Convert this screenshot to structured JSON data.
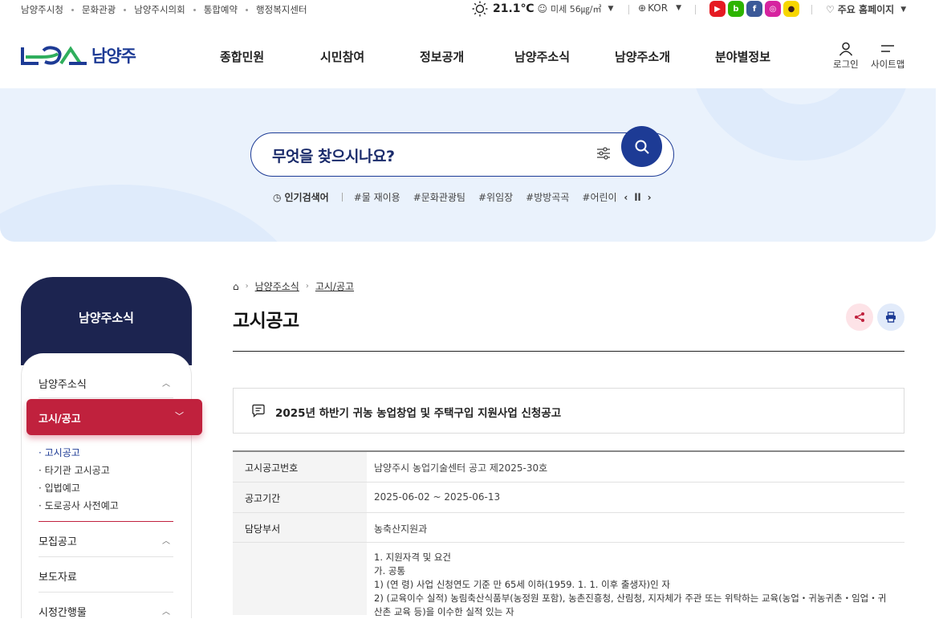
{
  "topbar": {
    "links": [
      "남양주시청",
      "문화관광",
      "남양주시의회",
      "통합예약",
      "행정복지센터"
    ],
    "temperature": "21.1℃",
    "fine_dust": "미세 56㎍/㎥",
    "language": "KOR",
    "sns": [
      {
        "name": "youtube-icon",
        "color": "#e51b23",
        "glyph": "▶"
      },
      {
        "name": "blog-icon",
        "color": "#2db400",
        "glyph": "b"
      },
      {
        "name": "facebook-icon",
        "color": "#3b5998",
        "glyph": "f"
      },
      {
        "name": "instagram-icon",
        "color": "#d6249f",
        "glyph": "◎"
      },
      {
        "name": "kakao-icon",
        "color": "#f7d600",
        "glyph": "●"
      }
    ],
    "main_home": "주요 홈페이지"
  },
  "header": {
    "logo_text": "남양주",
    "nav": [
      "종합민원",
      "시민참여",
      "정보공개",
      "남양주소식",
      "남양주소개",
      "분야별정보"
    ],
    "login": "로그인",
    "sitemap": "사이트맵"
  },
  "search": {
    "placeholder": "무엇을 찾으시나요?",
    "popular_title": "인기검색어",
    "tags": [
      "#물 재이용",
      "#문화관광팀",
      "#위임장",
      "#방방곡곡",
      "#어린이"
    ]
  },
  "sidebar": {
    "title": "남양주소식",
    "items": [
      {
        "label": "남양주소식"
      },
      {
        "label": "고시/공고"
      },
      {
        "label": "모집공고"
      },
      {
        "label": "보도자료"
      },
      {
        "label": "시정간행물"
      }
    ],
    "sub_items": [
      "고시공고",
      "타기관 고시공고",
      "입법예고",
      "도로공사 사전예고"
    ]
  },
  "breadcrumb": [
    "남양주소식",
    "고시/공고"
  ],
  "page_title": "고시공고",
  "notice": {
    "title": "2025년 하반기 귀농 농업창업 및 주택구입 지원사업 신청공고",
    "rows": [
      {
        "label": "고시공고번호",
        "value": "남양주시 농업기술센터 공고 제2025-30호"
      },
      {
        "label": "공고기간",
        "value": "2025-06-02 ~ 2025-06-13"
      },
      {
        "label": "담당부서",
        "value": "농축산지원과"
      }
    ],
    "detail_lines": [
      "1. 지원자격 및 요건",
      "가. 공통",
      "1) (연 령) 사업 신청연도 기준 만 65세 이하(1959. 1. 1. 이후 출생자)인 자",
      "2) (교육이수 실적) 농림축산식품부(농정원 포함), 농촌진흥청, 산림청, 지자체가 주관 또는 위탁하는 교육(농업・귀농귀촌・임업・귀",
      "산촌 교육 등)을 이수한 실적 있는 자"
    ]
  }
}
